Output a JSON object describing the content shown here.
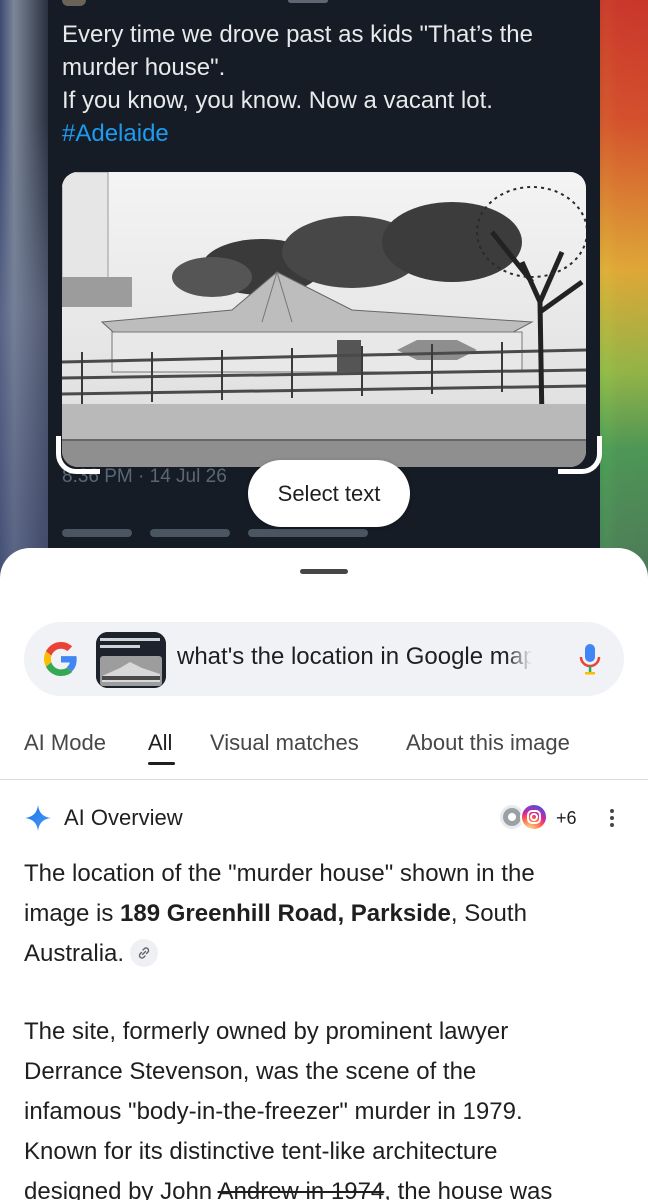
{
  "tweet": {
    "lines": [
      "Every time we drove past as kids \"That’s the",
      "murder house\".",
      "If you know, you know. Now a vacant lot."
    ],
    "hashtag": "#Adelaide",
    "timestamp": "8:36 PM · 14 Jul 26"
  },
  "lens": {
    "select_text_label": "Select text"
  },
  "search": {
    "query": "what's the location in Google maps"
  },
  "tabs": [
    {
      "label": "AI Mode"
    },
    {
      "label": "All"
    },
    {
      "label": "Visual matches"
    },
    {
      "label": "About this image"
    }
  ],
  "ai_overview": {
    "title": "AI Overview",
    "sources_count": "+6",
    "para1": {
      "pre": "The location of the \"murder house\" shown in the",
      "line2_pre": "image is ",
      "bold": "189 Greenhill Road, Parkside",
      "line2_post": ", South",
      "line3": "Australia."
    },
    "para2": {
      "lines": [
        "The site, formerly owned by prominent lawyer",
        "Derrance Stevenson, was the scene of the",
        "infamous \"body-in-the-freezer\" murder in 1979.",
        "Known for its distinctive tent-like architecture"
      ],
      "last_pre": "designed by John ",
      "last_strike": "Andrew in 1974",
      "last_post": ", the house was"
    }
  },
  "colors": {
    "google_blue": "#4285F4",
    "google_red": "#EA4335",
    "google_yellow": "#FBBC05",
    "google_green": "#34A853",
    "hashtag": "#1d9bf0"
  }
}
